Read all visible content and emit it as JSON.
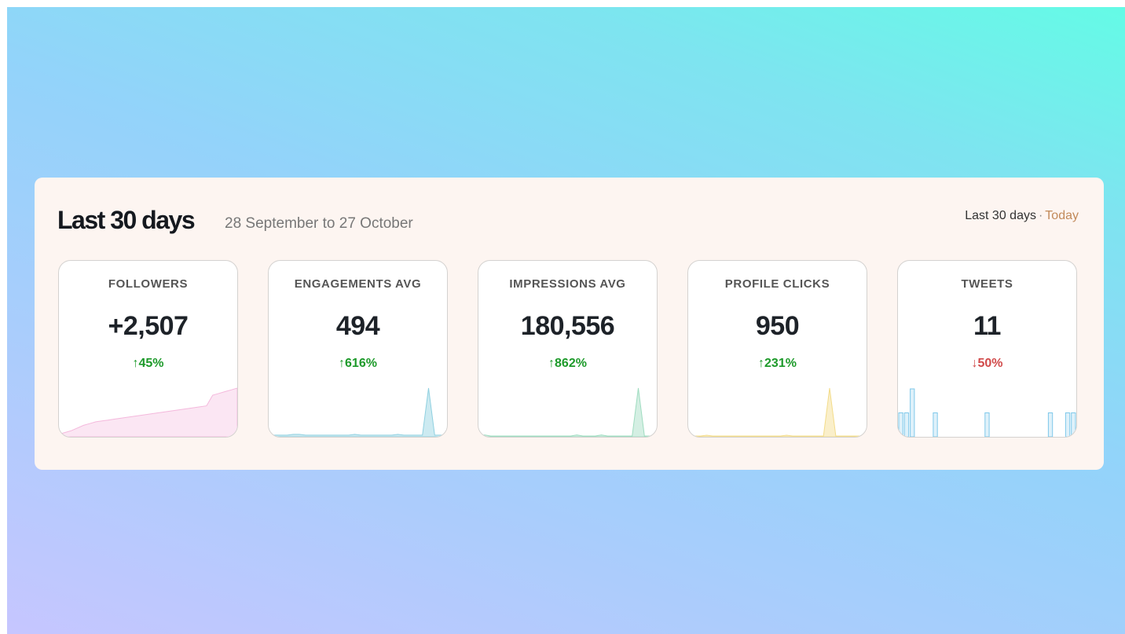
{
  "header": {
    "title": "Last 30 days",
    "range": "28 September to 27 October",
    "period_current": "Last 30 days",
    "period_separator": "·",
    "period_today": "Today"
  },
  "colors": {
    "up": "#1d9a2a",
    "down": "#d14a4a",
    "followers": "#f4b8dc",
    "engagements": "#8fd0e0",
    "impressions": "#9fdcc0",
    "profile_clicks": "#f3dc8a",
    "tweets": "#7fc9ea"
  },
  "cards": [
    {
      "label": "FOLLOWERS",
      "value": "+2,507",
      "change": "45%",
      "direction": "up",
      "arrow_icon": "arrow-up-icon"
    },
    {
      "label": "ENGAGEMENTS AVG",
      "value": "494",
      "change": "616%",
      "direction": "up",
      "arrow_icon": "arrow-up-icon"
    },
    {
      "label": "IMPRESSIONS AVG",
      "value": "180,556",
      "change": "862%",
      "direction": "up",
      "arrow_icon": "arrow-up-icon"
    },
    {
      "label": "PROFILE CLICKS",
      "value": "950",
      "change": "231%",
      "direction": "up",
      "arrow_icon": "arrow-up-icon"
    },
    {
      "label": "TWEETS",
      "value": "11",
      "change": "50%",
      "direction": "down",
      "arrow_icon": "arrow-down-icon"
    }
  ],
  "chart_data": [
    {
      "type": "area",
      "series": [
        {
          "values": [
            2,
            4,
            6,
            9,
            12,
            14,
            16,
            17,
            18,
            19,
            20,
            21,
            22,
            23,
            24,
            25,
            26,
            27,
            28,
            29,
            30,
            31,
            32,
            33,
            34,
            46,
            48,
            50,
            52,
            54
          ]
        }
      ]
    },
    {
      "type": "area",
      "series": [
        {
          "values": [
            1,
            1,
            1,
            1,
            2,
            2,
            1,
            1,
            1,
            1,
            1,
            1,
            1,
            1,
            2,
            1,
            1,
            1,
            1,
            1,
            1,
            2,
            1,
            1,
            1,
            1,
            58,
            1,
            1,
            1
          ]
        }
      ]
    },
    {
      "type": "area",
      "series": [
        {
          "values": [
            0,
            1,
            0,
            0,
            0,
            0,
            0,
            0,
            0,
            0,
            0,
            0,
            0,
            0,
            0,
            0,
            1,
            0,
            0,
            0,
            1,
            0,
            0,
            0,
            0,
            0,
            45,
            0,
            0,
            0
          ]
        }
      ]
    },
    {
      "type": "area",
      "series": [
        {
          "values": [
            1,
            0,
            0,
            1,
            0,
            0,
            0,
            0,
            0,
            0,
            0,
            0,
            0,
            0,
            0,
            0,
            1,
            0,
            0,
            0,
            0,
            0,
            0,
            60,
            0,
            0,
            0,
            0,
            0,
            1
          ]
        }
      ]
    },
    {
      "type": "bar",
      "series": [
        {
          "values": [
            1,
            1,
            2,
            0,
            0,
            0,
            1,
            0,
            0,
            0,
            0,
            0,
            0,
            0,
            0,
            1,
            0,
            0,
            0,
            0,
            0,
            0,
            0,
            0,
            0,
            0,
            1,
            0,
            0,
            1,
            1
          ]
        }
      ]
    }
  ]
}
